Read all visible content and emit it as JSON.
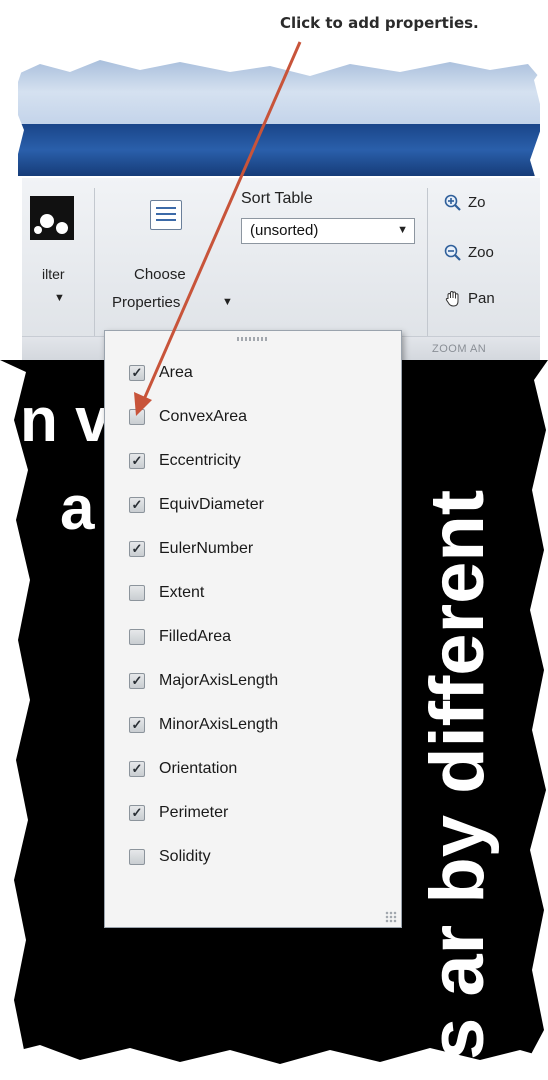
{
  "annotation": {
    "text": "Click to add properties."
  },
  "ribbon": {
    "filter_label": "ilter",
    "choose_properties_line1": "Choose",
    "choose_properties_line2": "Properties",
    "sort_table_label": "Sort Table",
    "sort_table_value": "(unsorted)",
    "zoom_in_label": "Zo",
    "zoom_out_label": "Zoo",
    "pan_label": "Pan",
    "zoom_group_label": "ZOOM AN"
  },
  "background_text": {
    "line1": "n v            ed",
    "line2": "a            nat",
    "vertical": "s ar       by different"
  },
  "properties_menu": {
    "items": [
      {
        "label": "Area",
        "checked": true
      },
      {
        "label": "ConvexArea",
        "checked": false
      },
      {
        "label": "Eccentricity",
        "checked": true
      },
      {
        "label": "EquivDiameter",
        "checked": true
      },
      {
        "label": "EulerNumber",
        "checked": true
      },
      {
        "label": "Extent",
        "checked": false
      },
      {
        "label": "FilledArea",
        "checked": false
      },
      {
        "label": "MajorAxisLength",
        "checked": true
      },
      {
        "label": "MinorAxisLength",
        "checked": true
      },
      {
        "label": "Orientation",
        "checked": true
      },
      {
        "label": "Perimeter",
        "checked": true
      },
      {
        "label": "Solidity",
        "checked": false
      }
    ]
  },
  "colors": {
    "arrow": "#c8543a",
    "header_light": "#c6d6ea",
    "header_dark": "#1f4f95",
    "menu_bg": "#f4f4f4"
  }
}
